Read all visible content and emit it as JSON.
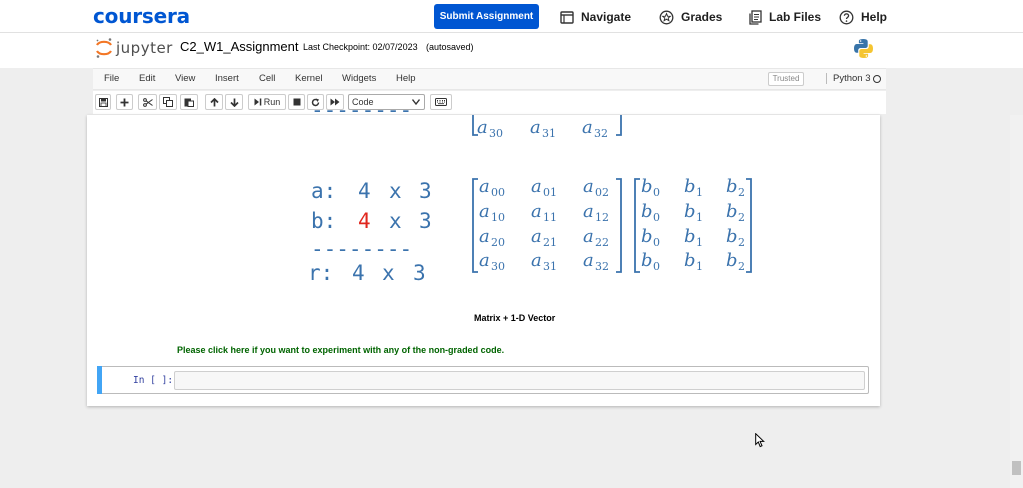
{
  "coursera": {
    "logo": "coursera",
    "submit_label": "Submit Assignment",
    "nav": [
      {
        "label": "Navigate",
        "icon": "navigate-icon"
      },
      {
        "label": "Grades",
        "icon": "grades-icon"
      },
      {
        "label": "Lab Files",
        "icon": "lab-files-icon"
      },
      {
        "label": "Help",
        "icon": "help-icon"
      }
    ]
  },
  "jupyter": {
    "logo_text": "jupyter",
    "notebook_name": "C2_W1_Assignment",
    "checkpoint": "Last Checkpoint: 02/07/2023",
    "autosaved": "(autosaved)",
    "menu": [
      "File",
      "Edit",
      "View",
      "Insert",
      "Cell",
      "Kernel",
      "Widgets",
      "Help"
    ],
    "trusted": "Trusted",
    "kernel": "Python 3",
    "toolbar": {
      "run_label": "Run",
      "cell_type": "Code"
    }
  },
  "figure": {
    "dims": {
      "a_label": "a:",
      "b_label": "b:",
      "r_label": "r:",
      "rows_a": "4",
      "rows_b": "4",
      "rows_r": "4",
      "times": "x",
      "cols": "3",
      "dashes": "--------"
    },
    "matrix_var": "a",
    "vector_var": "b",
    "matrix_subs": [
      [
        "00",
        "01",
        "02"
      ],
      [
        "10",
        "11",
        "12"
      ],
      [
        "20",
        "21",
        "22"
      ],
      [
        "30",
        "31",
        "32"
      ]
    ],
    "vector_subs": [
      "0",
      "1",
      "2"
    ],
    "top_partial_subs": [
      "30",
      "31",
      "32"
    ],
    "colors": {
      "blue": "#3b73ad",
      "red": "#e0271e"
    }
  },
  "caption": "Matrix + 1-D Vector",
  "experiment_text": "Please click here if you want to experiment with any of the non-graded code.",
  "code_cell": {
    "prompt": "In [ ]:"
  }
}
